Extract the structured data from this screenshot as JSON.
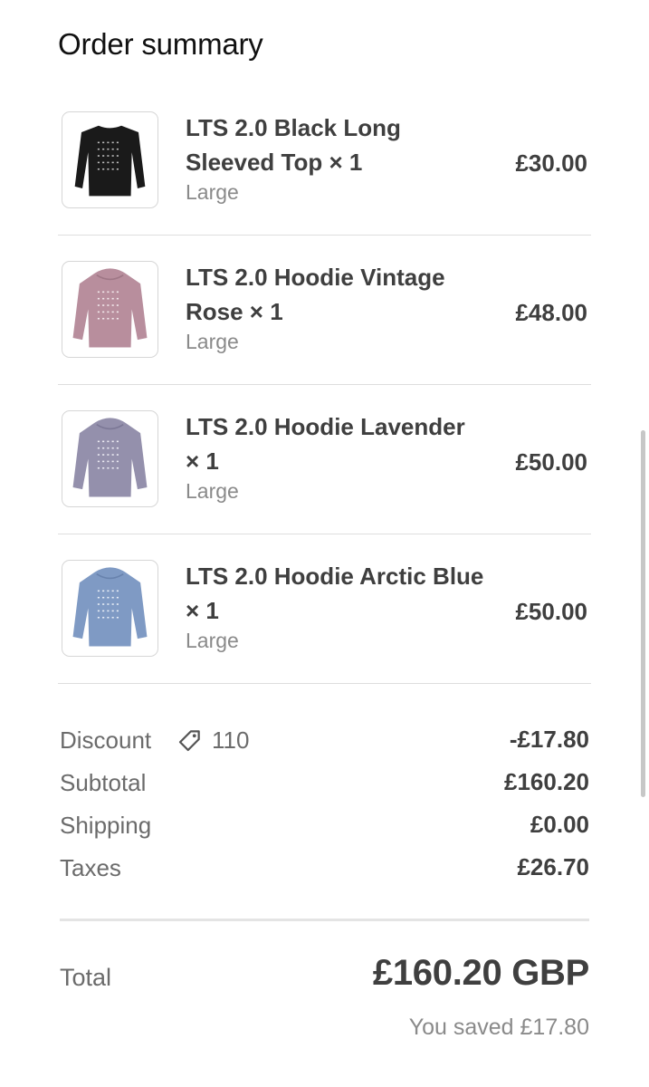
{
  "summary_title": "Order summary",
  "items": [
    {
      "name": "LTS 2.0 Black Long Sleeved Top × 1",
      "variant": "Large",
      "price": "£30.00",
      "color": "#1a1a1a"
    },
    {
      "name": "LTS 2.0 Hoodie Vintage Rose × 1",
      "variant": "Large",
      "price": "£48.00",
      "color": "#b88e9d"
    },
    {
      "name": "LTS 2.0 Hoodie Lavender × 1",
      "variant": "Large",
      "price": "£50.00",
      "color": "#9490ac"
    },
    {
      "name": "LTS 2.0 Hoodie Arctic Blue × 1",
      "variant": "Large",
      "price": "£50.00",
      "color": "#7f9ac4"
    }
  ],
  "discount": {
    "label": "Discount",
    "code": "110",
    "value": "-£17.80",
    "icon": "tag-icon"
  },
  "subtotal": {
    "label": "Subtotal",
    "value": "£160.20"
  },
  "shipping": {
    "label": "Shipping",
    "value": "£0.00"
  },
  "taxes": {
    "label": "Taxes",
    "value": "£26.70"
  },
  "total": {
    "label": "Total",
    "value": "£160.20 GBP",
    "saved": "You saved £17.80"
  }
}
